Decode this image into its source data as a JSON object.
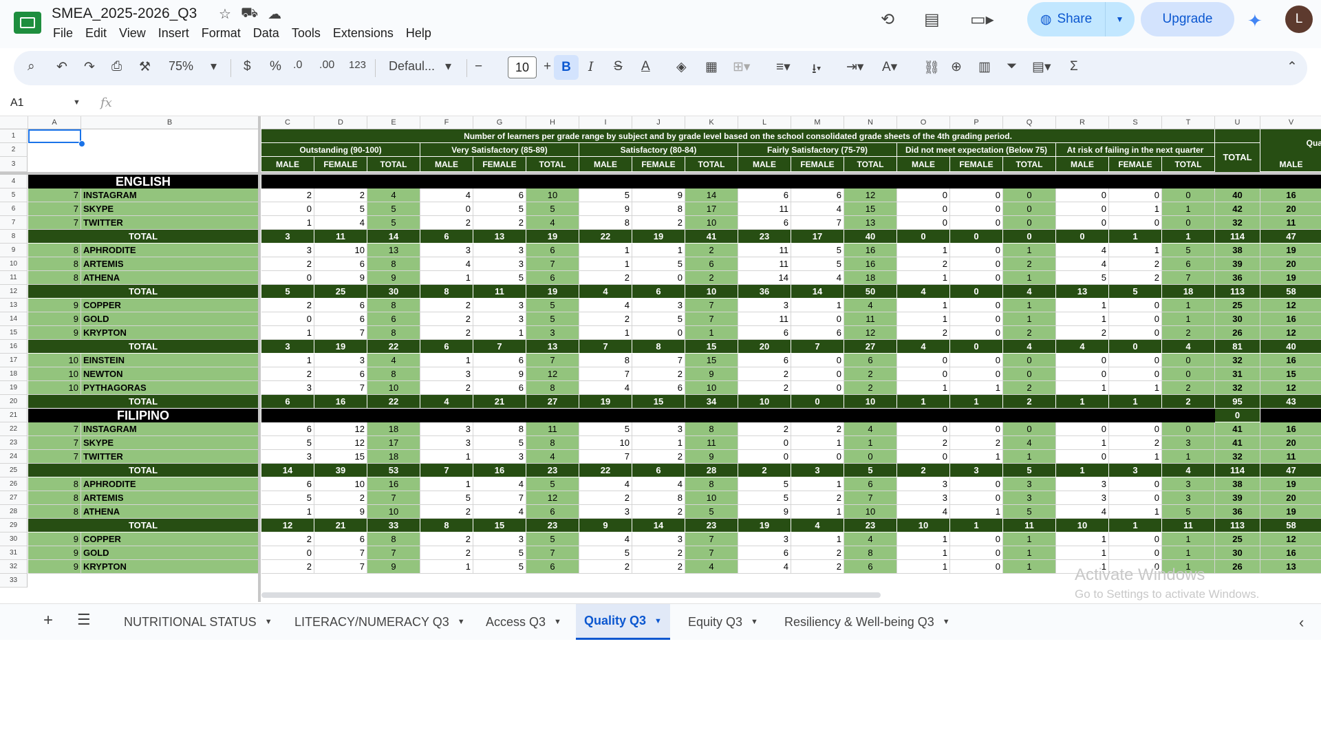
{
  "doc": {
    "title": "SMEA_2025-2026_Q3",
    "menus": [
      "File",
      "Edit",
      "View",
      "Insert",
      "Format",
      "Data",
      "Tools",
      "Extensions",
      "Help"
    ]
  },
  "header": {
    "share_label": "Share",
    "upgrade_label": "Upgrade",
    "avatar_letter": "L"
  },
  "toolbar": {
    "zoom": "75%",
    "font": "Defaul...",
    "font_size": "10",
    "currency": "$",
    "percent": "%",
    "decrease_decimals": ".0",
    "increase_decimals": ".00",
    "number_format": "123",
    "bold": "B",
    "italic": "I"
  },
  "formula_bar": {
    "cell_ref": "A1",
    "fx": "fx"
  },
  "columns": [
    "A",
    "B",
    "C",
    "D",
    "E",
    "F",
    "G",
    "H",
    "I",
    "J",
    "K",
    "L",
    "M",
    "N",
    "O",
    "P",
    "Q",
    "R",
    "S",
    "T",
    "U",
    "V"
  ],
  "sheet": {
    "banner": "Number of learners per grade range by subject and by grade level based on the school consolidated grade sheets of the 4th grading period.",
    "groups": [
      "Outstanding (90-100)",
      "Very Satisfactory (85-89)",
      "Satisfactory (80-84)",
      "Fairly Satisfactory (75-79)",
      "Did not meet expectation (Below 75)",
      "At risk of failing in the next quarter"
    ],
    "sub_headers": [
      "MALE",
      "FEMALE",
      "TOTAL"
    ],
    "total_col": "TOTAL",
    "next_group": "Qua",
    "next_sub": "MALE",
    "rows": [
      {
        "n": 4,
        "type": "subject",
        "label": "ENGLISH"
      },
      {
        "n": 5,
        "g": "7",
        "s": "INSTAGRAM",
        "v": [
          "2",
          "2",
          "4",
          "4",
          "6",
          "10",
          "5",
          "9",
          "14",
          "6",
          "6",
          "12",
          "0",
          "0",
          "0",
          "0",
          "0",
          "0",
          "40",
          "16"
        ]
      },
      {
        "n": 6,
        "g": "7",
        "s": "SKYPE",
        "v": [
          "0",
          "5",
          "5",
          "0",
          "5",
          "5",
          "9",
          "8",
          "17",
          "11",
          "4",
          "15",
          "0",
          "0",
          "0",
          "0",
          "1",
          "1",
          "42",
          "20"
        ]
      },
      {
        "n": 7,
        "g": "7",
        "s": "TWITTER",
        "v": [
          "1",
          "4",
          "5",
          "2",
          "2",
          "4",
          "8",
          "2",
          "10",
          "6",
          "7",
          "13",
          "0",
          "0",
          "0",
          "0",
          "0",
          "0",
          "32",
          "11"
        ]
      },
      {
        "n": 8,
        "type": "total",
        "label": "TOTAL",
        "v": [
          "3",
          "11",
          "14",
          "6",
          "13",
          "19",
          "22",
          "19",
          "41",
          "23",
          "17",
          "40",
          "0",
          "0",
          "0",
          "0",
          "1",
          "1",
          "114",
          "47"
        ]
      },
      {
        "n": 9,
        "g": "8",
        "s": "APHRODITE",
        "v": [
          "3",
          "10",
          "13",
          "3",
          "3",
          "6",
          "1",
          "1",
          "2",
          "11",
          "5",
          "16",
          "1",
          "0",
          "1",
          "4",
          "1",
          "5",
          "38",
          "19"
        ]
      },
      {
        "n": 10,
        "g": "8",
        "s": "ARTEMIS",
        "v": [
          "2",
          "6",
          "8",
          "4",
          "3",
          "7",
          "1",
          "5",
          "6",
          "11",
          "5",
          "16",
          "2",
          "0",
          "2",
          "4",
          "2",
          "6",
          "39",
          "20"
        ]
      },
      {
        "n": 11,
        "g": "8",
        "s": "ATHENA",
        "v": [
          "0",
          "9",
          "9",
          "1",
          "5",
          "6",
          "2",
          "0",
          "2",
          "14",
          "4",
          "18",
          "1",
          "0",
          "1",
          "5",
          "2",
          "7",
          "36",
          "19"
        ]
      },
      {
        "n": 12,
        "type": "total",
        "label": "TOTAL",
        "v": [
          "5",
          "25",
          "30",
          "8",
          "11",
          "19",
          "4",
          "6",
          "10",
          "36",
          "14",
          "50",
          "4",
          "0",
          "4",
          "13",
          "5",
          "18",
          "113",
          "58"
        ]
      },
      {
        "n": 13,
        "g": "9",
        "s": "COPPER",
        "v": [
          "2",
          "6",
          "8",
          "2",
          "3",
          "5",
          "4",
          "3",
          "7",
          "3",
          "1",
          "4",
          "1",
          "0",
          "1",
          "1",
          "0",
          "1",
          "25",
          "12"
        ]
      },
      {
        "n": 14,
        "g": "9",
        "s": "GOLD",
        "v": [
          "0",
          "6",
          "6",
          "2",
          "3",
          "5",
          "2",
          "5",
          "7",
          "11",
          "0",
          "11",
          "1",
          "0",
          "1",
          "1",
          "0",
          "1",
          "30",
          "16"
        ]
      },
      {
        "n": 15,
        "g": "9",
        "s": "KRYPTON",
        "v": [
          "1",
          "7",
          "8",
          "2",
          "1",
          "3",
          "1",
          "0",
          "1",
          "6",
          "6",
          "12",
          "2",
          "0",
          "2",
          "2",
          "0",
          "2",
          "26",
          "12"
        ]
      },
      {
        "n": 16,
        "type": "total",
        "label": "TOTAL",
        "v": [
          "3",
          "19",
          "22",
          "6",
          "7",
          "13",
          "7",
          "8",
          "15",
          "20",
          "7",
          "27",
          "4",
          "0",
          "4",
          "4",
          "0",
          "4",
          "81",
          "40"
        ]
      },
      {
        "n": 17,
        "g": "10",
        "s": "EINSTEIN",
        "v": [
          "1",
          "3",
          "4",
          "1",
          "6",
          "7",
          "8",
          "7",
          "15",
          "6",
          "0",
          "6",
          "0",
          "0",
          "0",
          "0",
          "0",
          "0",
          "32",
          "16"
        ]
      },
      {
        "n": 18,
        "g": "10",
        "s": "NEWTON",
        "v": [
          "2",
          "6",
          "8",
          "3",
          "9",
          "12",
          "7",
          "2",
          "9",
          "2",
          "0",
          "2",
          "0",
          "0",
          "0",
          "0",
          "0",
          "0",
          "31",
          "15"
        ]
      },
      {
        "n": 19,
        "g": "10",
        "s": "PYTHAGORAS",
        "v": [
          "3",
          "7",
          "10",
          "2",
          "6",
          "8",
          "4",
          "6",
          "10",
          "2",
          "0",
          "2",
          "1",
          "1",
          "2",
          "1",
          "1",
          "2",
          "32",
          "12"
        ]
      },
      {
        "n": 20,
        "type": "total",
        "label": "TOTAL",
        "v": [
          "6",
          "16",
          "22",
          "4",
          "21",
          "27",
          "19",
          "15",
          "34",
          "10",
          "0",
          "10",
          "1",
          "1",
          "2",
          "1",
          "1",
          "2",
          "95",
          "43"
        ]
      },
      {
        "n": 21,
        "type": "subject",
        "label": "FILIPINO",
        "u": "0"
      },
      {
        "n": 22,
        "g": "7",
        "s": "INSTAGRAM",
        "v": [
          "6",
          "12",
          "18",
          "3",
          "8",
          "11",
          "5",
          "3",
          "8",
          "2",
          "2",
          "4",
          "0",
          "0",
          "0",
          "0",
          "0",
          "0",
          "41",
          "16"
        ]
      },
      {
        "n": 23,
        "g": "7",
        "s": "SKYPE",
        "v": [
          "5",
          "12",
          "17",
          "3",
          "5",
          "8",
          "10",
          "1",
          "11",
          "0",
          "1",
          "1",
          "2",
          "2",
          "4",
          "1",
          "2",
          "3",
          "41",
          "20"
        ]
      },
      {
        "n": 24,
        "g": "7",
        "s": "TWITTER",
        "v": [
          "3",
          "15",
          "18",
          "1",
          "3",
          "4",
          "7",
          "2",
          "9",
          "0",
          "0",
          "0",
          "0",
          "1",
          "1",
          "0",
          "1",
          "1",
          "32",
          "11"
        ]
      },
      {
        "n": 25,
        "type": "total",
        "label": "TOTAL",
        "v": [
          "14",
          "39",
          "53",
          "7",
          "16",
          "23",
          "22",
          "6",
          "28",
          "2",
          "3",
          "5",
          "2",
          "3",
          "5",
          "1",
          "3",
          "4",
          "114",
          "47"
        ]
      },
      {
        "n": 26,
        "g": "8",
        "s": "APHRODITE",
        "v": [
          "6",
          "10",
          "16",
          "1",
          "4",
          "5",
          "4",
          "4",
          "8",
          "5",
          "1",
          "6",
          "3",
          "0",
          "3",
          "3",
          "0",
          "3",
          "38",
          "19"
        ]
      },
      {
        "n": 27,
        "g": "8",
        "s": "ARTEMIS",
        "v": [
          "5",
          "2",
          "7",
          "5",
          "7",
          "12",
          "2",
          "8",
          "10",
          "5",
          "2",
          "7",
          "3",
          "0",
          "3",
          "3",
          "0",
          "3",
          "39",
          "20"
        ]
      },
      {
        "n": 28,
        "g": "8",
        "s": "ATHENA",
        "v": [
          "1",
          "9",
          "10",
          "2",
          "4",
          "6",
          "3",
          "2",
          "5",
          "9",
          "1",
          "10",
          "4",
          "1",
          "5",
          "4",
          "1",
          "5",
          "36",
          "19"
        ]
      },
      {
        "n": 29,
        "type": "total",
        "label": "TOTAL",
        "v": [
          "12",
          "21",
          "33",
          "8",
          "15",
          "23",
          "9",
          "14",
          "23",
          "19",
          "4",
          "23",
          "10",
          "1",
          "11",
          "10",
          "1",
          "11",
          "113",
          "58"
        ]
      },
      {
        "n": 30,
        "g": "9",
        "s": "COPPER",
        "v": [
          "2",
          "6",
          "8",
          "2",
          "3",
          "5",
          "4",
          "3",
          "7",
          "3",
          "1",
          "4",
          "1",
          "0",
          "1",
          "1",
          "0",
          "1",
          "25",
          "12"
        ]
      },
      {
        "n": 31,
        "g": "9",
        "s": "GOLD",
        "v": [
          "0",
          "7",
          "7",
          "2",
          "5",
          "7",
          "5",
          "2",
          "7",
          "6",
          "2",
          "8",
          "1",
          "0",
          "1",
          "1",
          "0",
          "1",
          "30",
          "16"
        ]
      },
      {
        "n": 32,
        "g": "9",
        "s": "KRYPTON",
        "v": [
          "2",
          "7",
          "9",
          "1",
          "5",
          "6",
          "2",
          "2",
          "4",
          "4",
          "2",
          "6",
          "1",
          "0",
          "1",
          "1",
          "0",
          "1",
          "26",
          "13"
        ]
      }
    ]
  },
  "tabs": [
    {
      "label": "NUTRITIONAL STATUS",
      "active": false
    },
    {
      "label": "LITERACY/NUMERACY Q3",
      "active": false
    },
    {
      "label": "Access Q3",
      "active": false
    },
    {
      "label": "Quality Q3",
      "active": true
    },
    {
      "label": "Equity Q3",
      "active": false
    },
    {
      "label": "Resiliency & Well-being Q3",
      "active": false
    }
  ],
  "watermark": {
    "line1": "Activate Windows",
    "line2": "Go to Settings to activate Windows."
  },
  "colors": {
    "dark_green": "#274e13",
    "light_green": "#93c47d",
    "subject_black": "#000000",
    "accent_blue": "#0b57d0"
  }
}
